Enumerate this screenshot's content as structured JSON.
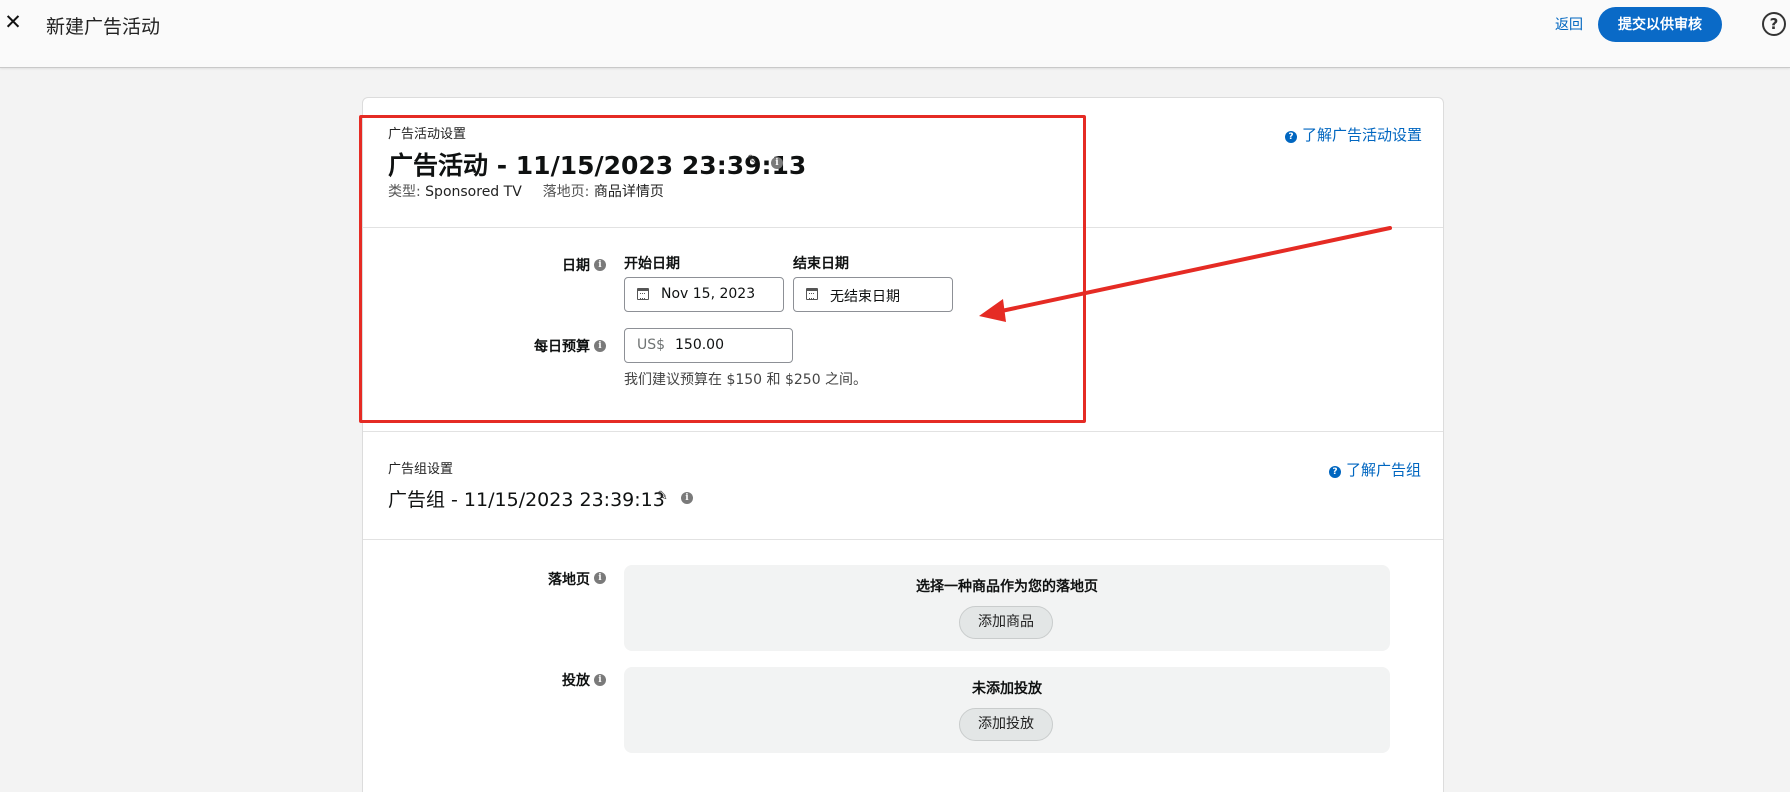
{
  "header": {
    "close_icon": "✕",
    "title": "新建广告活动",
    "back_label": "返回",
    "submit_label": "提交以供审核",
    "help_icon": "?"
  },
  "campaign_settings": {
    "section_label": "广告活动设置",
    "learn_link": "了解广告活动设置",
    "name": "广告活动 - 11/15/2023 23:39:13",
    "type_label": "类型:",
    "type_value": "Sponsored TV",
    "landing_label": "落地页:",
    "landing_value": "商品详情页",
    "date_label": "日期",
    "start_date_title": "开始日期",
    "start_date_value": "Nov 15, 2023",
    "end_date_title": "结束日期",
    "end_date_value": "无结束日期",
    "budget_label": "每日预算",
    "budget_currency": "US$",
    "budget_value": "150.00",
    "budget_hint": "我们建议预算在 $150 和 $250 之间。"
  },
  "adgroup_settings": {
    "section_label": "广告组设置",
    "learn_link": "了解广告组",
    "name": "广告组 - 11/15/2023 23:39:13",
    "landing_label": "落地页",
    "landing_empty_message": "选择一种商品作为您的落地页",
    "add_product_label": "添加商品",
    "targeting_label": "投放",
    "targeting_empty_message": "未添加投放",
    "add_targeting_label": "添加投放"
  },
  "annotation": {
    "color": "#e52b24"
  },
  "icons": {
    "info": "i",
    "question": "?",
    "pencil": "✎"
  }
}
